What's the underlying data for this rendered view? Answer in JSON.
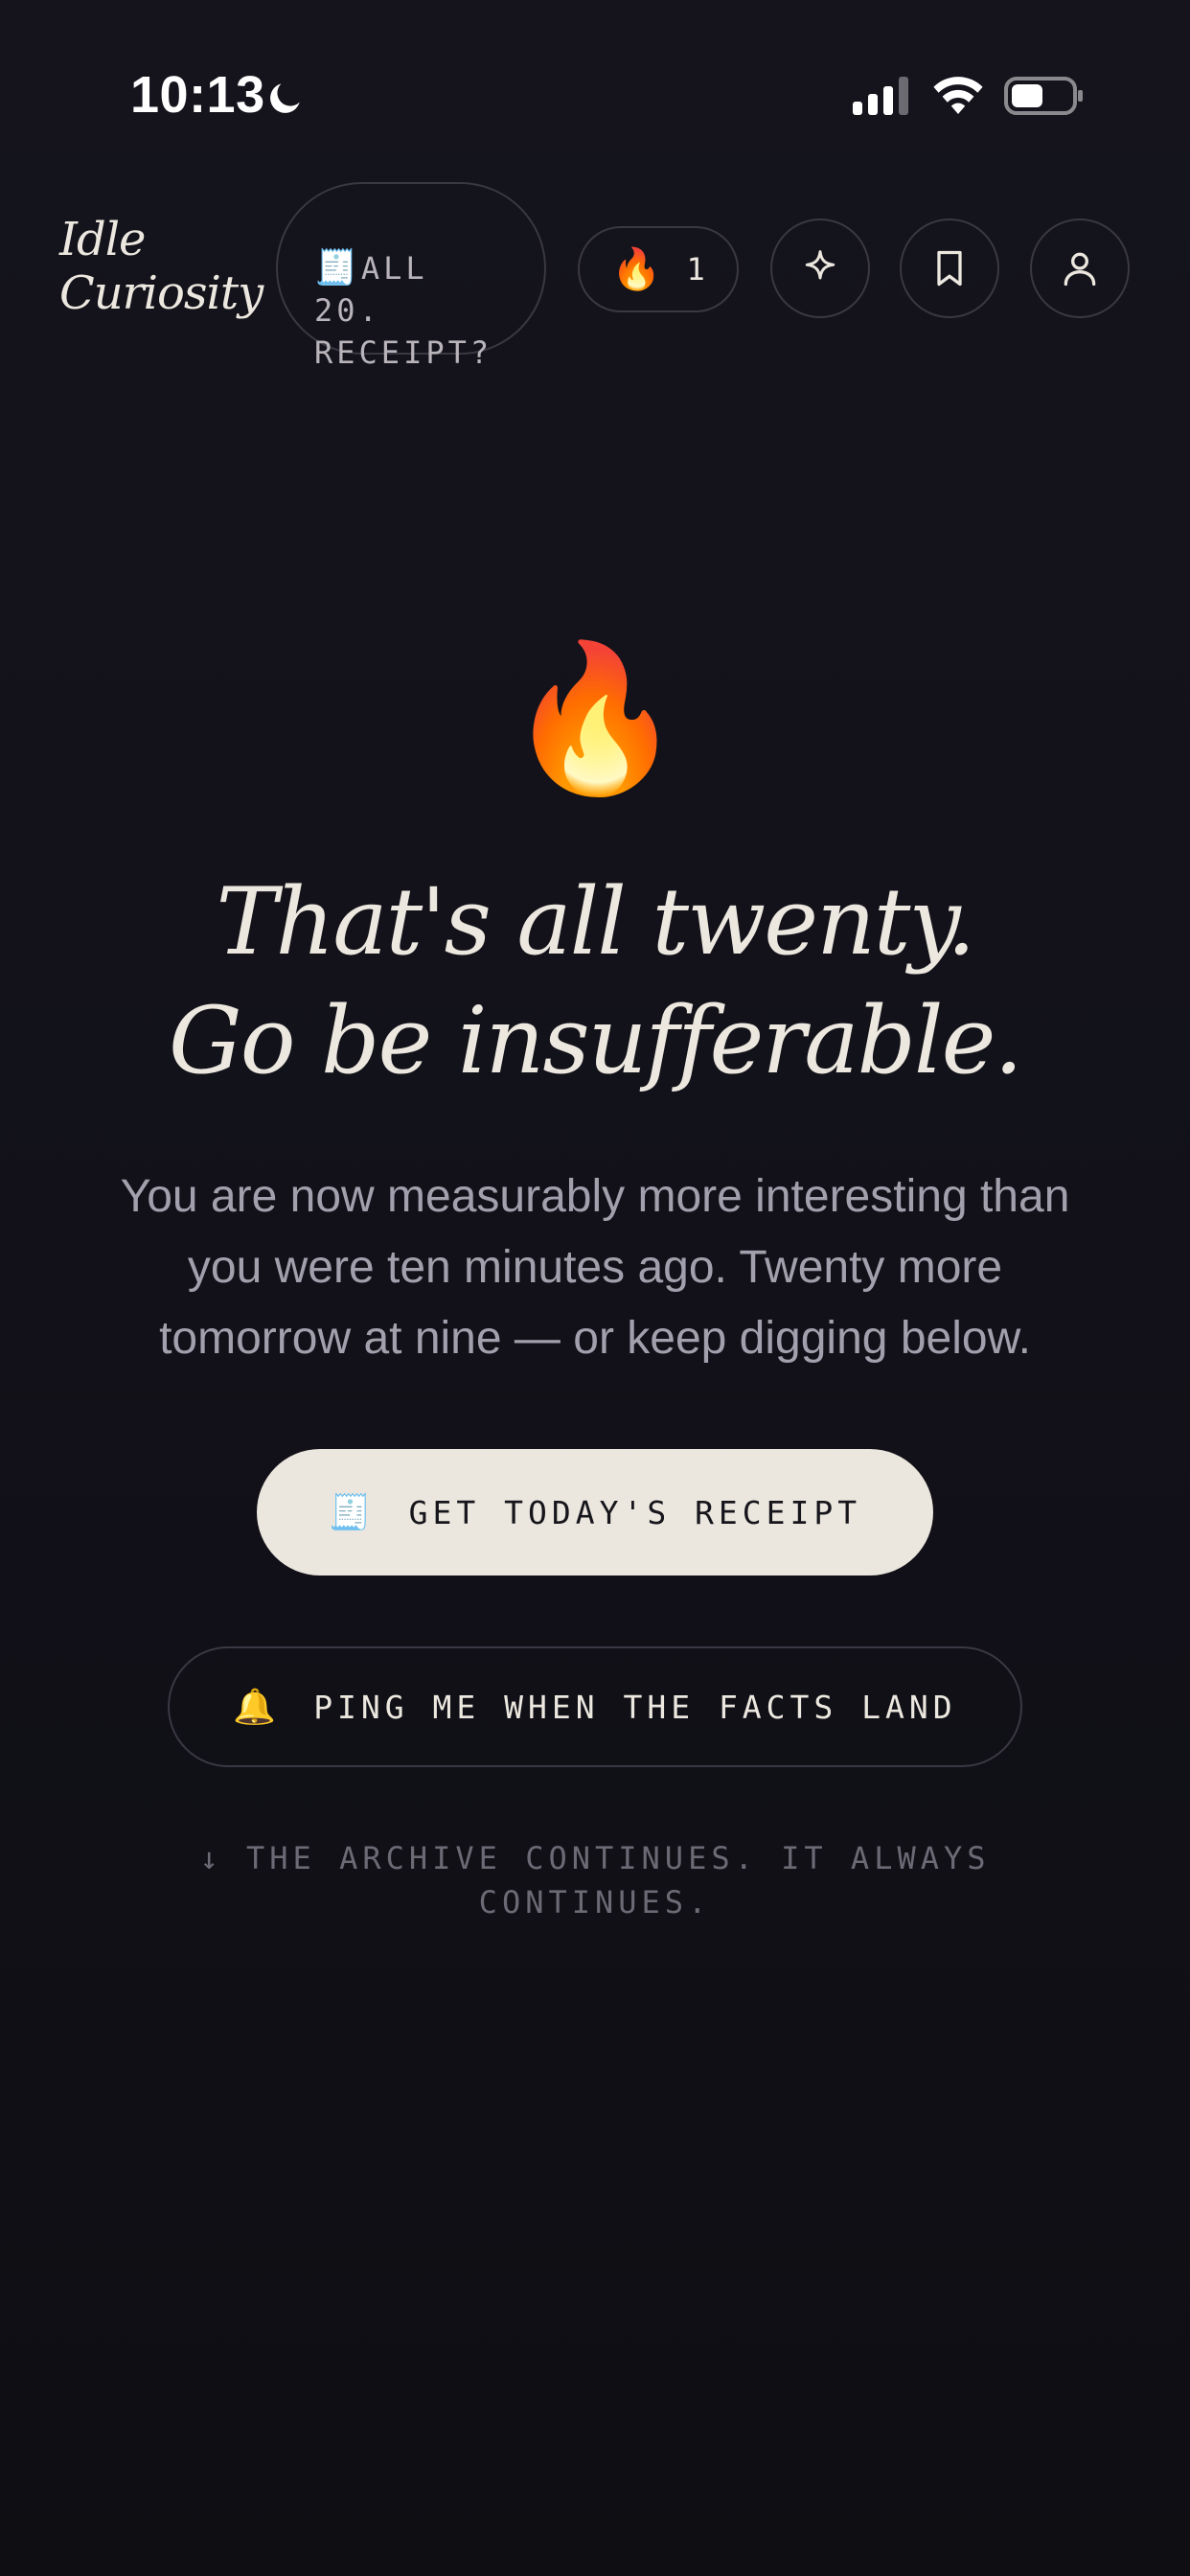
{
  "status_bar": {
    "time": "10:13",
    "icons": [
      "moon-icon",
      "cellular-signal-icon",
      "wifi-icon",
      "battery-icon"
    ]
  },
  "header": {
    "brand_line1": "Idle",
    "brand_line2": "Curiosity",
    "receipt_pill": {
      "icon": "🧾",
      "text": "ALL\n20.\nRECEIPT?"
    },
    "streak": {
      "icon": "🔥",
      "count": "1"
    },
    "icons": [
      "sparkle-icon",
      "bookmark-icon",
      "profile-icon"
    ]
  },
  "main": {
    "emoji": "🔥",
    "headline_line1": "That's all twenty.",
    "headline_line2": "Go be insufferable.",
    "subtext": "You are now measurably more interesting than you were ten minutes ago. Twenty more tomorrow at nine — or keep digging below.",
    "primary_button": {
      "icon": "🧾",
      "label": "GET TODAY'S RECEIPT"
    },
    "secondary_button": {
      "icon": "🔔",
      "label": "PING ME WHEN THE FACTS LAND"
    },
    "footer_note": "↓ THE ARCHIVE CONTINUES. IT ALWAYS CONTINUES."
  },
  "colors": {
    "background": "#121119",
    "text_primary": "#ece8df",
    "text_muted": "#a3a0ad",
    "button_primary_bg": "#ebe7de",
    "border": "#3a3842"
  }
}
